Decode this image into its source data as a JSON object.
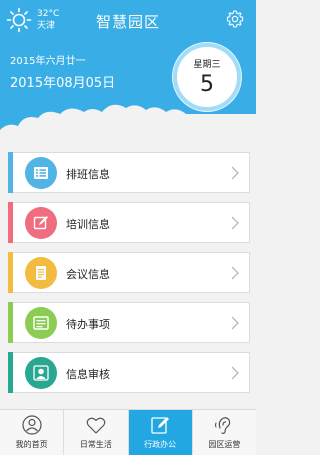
{
  "header": {
    "title": "智慧园区",
    "temperature": "32°C",
    "city": "天津",
    "lunar_date": "2015年六月廿一",
    "solar_date": "2015年08月05日",
    "weekday_label": "星期三",
    "weekday_number": "5"
  },
  "icons": {
    "weather": "sun-icon",
    "settings": "gear-icon",
    "arrow": "chevron-right-icon"
  },
  "menu": [
    {
      "label": "排班信息",
      "color": "#52b4e4",
      "icon": "list-icon"
    },
    {
      "label": "培训信息",
      "color": "#ef6d7e",
      "icon": "edit-icon"
    },
    {
      "label": "会议信息",
      "color": "#f2bc41",
      "icon": "document-icon"
    },
    {
      "label": "待办事项",
      "color": "#8dcc52",
      "icon": "checklist-icon"
    },
    {
      "label": "信息审核",
      "color": "#28a793",
      "icon": "user-search-icon"
    }
  ],
  "tabs": [
    {
      "label": "我的首页",
      "icon": "profile-icon",
      "active": false
    },
    {
      "label": "日常生活",
      "icon": "heart-icon",
      "active": false
    },
    {
      "label": "行政办公",
      "icon": "office-edit-icon",
      "active": true
    },
    {
      "label": "园区运营",
      "icon": "ear-icon",
      "active": false
    }
  ],
  "colors": {
    "header_bg": "#39aee6",
    "active_tab_bg": "#22a7e3"
  }
}
